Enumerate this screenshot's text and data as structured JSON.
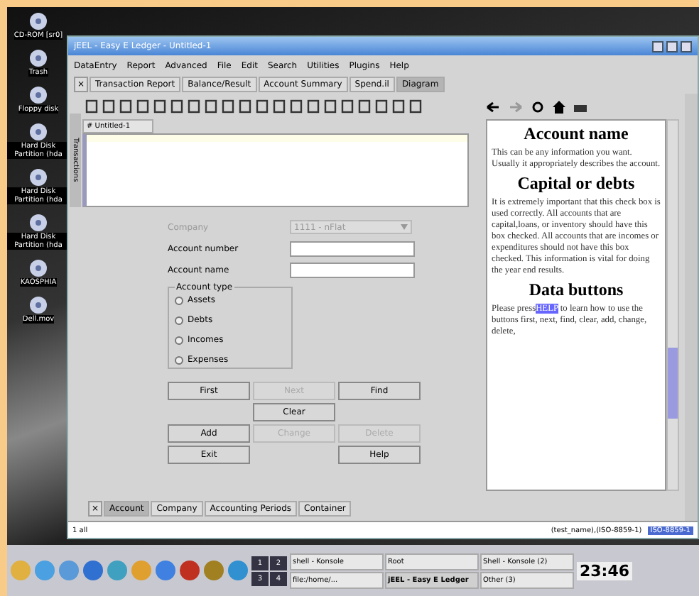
{
  "desktop_icons": [
    {
      "label": "CD-ROM [sr0]"
    },
    {
      "label": "Trash"
    },
    {
      "label": "Floppy disk"
    },
    {
      "label": "Hard Disk Partition (hda"
    },
    {
      "label": "Hard Disk Partition (hda"
    },
    {
      "label": "Hard Disk Partition (hda"
    },
    {
      "label": "KAOSPHIA"
    },
    {
      "label": "Dell.mov"
    }
  ],
  "window": {
    "title": "jEEL - Easy E Ledger - Untitled-1"
  },
  "menu": [
    "DataEntry",
    "Report",
    "Advanced",
    "File",
    "Edit",
    "Search",
    "Utilities",
    "Plugins",
    "Help"
  ],
  "report_tabs_close": "×",
  "bottom_tabs_close": "×",
  "report_tabs": [
    {
      "label": "Transaction Report",
      "selected": false
    },
    {
      "label": "Balance/Result",
      "selected": false
    },
    {
      "label": "Account Summary",
      "selected": false
    },
    {
      "label": "Spend.il",
      "selected": false
    },
    {
      "label": "Diagram",
      "selected": true
    }
  ],
  "side_tab": "Transactions",
  "editor_tab": "# Untitled-1",
  "form": {
    "company": {
      "label": "Company",
      "value": "1111 - nFlat",
      "disabled": true
    },
    "fields": [
      {
        "label": "Account number"
      },
      {
        "label": "Account name"
      }
    ],
    "account_type": {
      "legend": "Account type",
      "options": [
        {
          "label": "Assets",
          "selected": false
        },
        {
          "label": "Debts",
          "selected": false
        },
        {
          "label": "Incomes",
          "selected": false
        },
        {
          "label": "Expenses",
          "selected": false
        }
      ]
    },
    "button_rows": [
      [
        {
          "label": "First",
          "disabled": false
        },
        {
          "label": "Next",
          "disabled": true
        },
        {
          "label": "Find",
          "disabled": false
        }
      ],
      [
        null,
        {
          "label": "Clear",
          "disabled": false
        },
        null
      ],
      [
        {
          "label": "Add",
          "disabled": false
        },
        {
          "label": "Change",
          "disabled": true
        },
        {
          "label": "Delete",
          "disabled": true
        }
      ],
      [
        {
          "label": "Exit",
          "disabled": false
        },
        null,
        {
          "label": "Help",
          "disabled": false
        }
      ]
    ]
  },
  "help": {
    "sections": [
      {
        "heading": "Account name",
        "text": "This can be any information you want. Usually it appropriately describes the account."
      },
      {
        "heading": "Capital or debts",
        "text": "It is extremely important that this check box is used correctly.  All accounts that are capital,loans, or inventory should have this box checked. All accounts that are incomes or expenditures should not have this box checked.  This information is vital for doing the year end results."
      },
      {
        "heading": "Data buttons",
        "text": "Please press",
        "link": "HELP",
        "text_after": "to learn how to use the buttons first, next, find, clear, add, change, delete,"
      }
    ]
  },
  "bottom_tabs": [
    {
      "label": "Account",
      "selected": true
    },
    {
      "label": "Company",
      "selected": false
    },
    {
      "label": "Accounting Periods",
      "selected": false
    },
    {
      "label": "Container",
      "selected": false
    }
  ],
  "status_bar": {
    "left": "1 all",
    "right": "(test_name),(ISO-8859-1)",
    "mode": "ISO-8859-1"
  },
  "taskbar": {
    "pager": [
      "1",
      "2",
      "3",
      "4"
    ],
    "tasks": [
      {
        "label": "shell - Konsole",
        "selected": false
      },
      {
        "label": "Root",
        "selected": false
      },
      {
        "label": "Shell - Konsole (2)",
        "selected": false
      },
      {
        "label": "file:/home/...",
        "selected": false
      },
      {
        "label": "jEEL - Easy E Ledger",
        "selected": true
      },
      {
        "label": "Other (3)",
        "selected": false
      }
    ],
    "clock": "23:46"
  }
}
